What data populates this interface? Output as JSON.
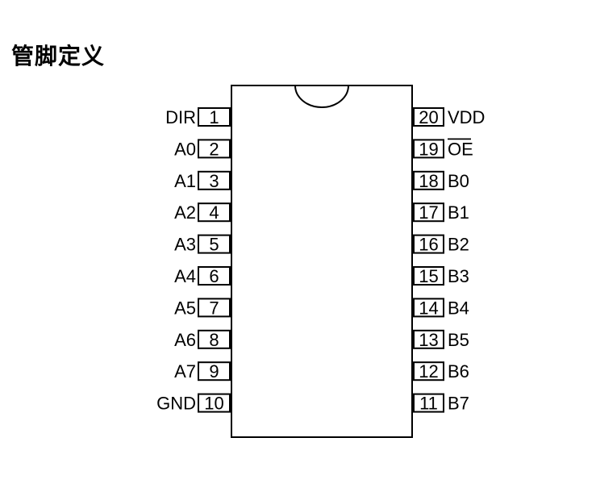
{
  "title": "管脚定义",
  "left_pins": [
    {
      "number": "1",
      "label": "DIR"
    },
    {
      "number": "2",
      "label": "A0"
    },
    {
      "number": "3",
      "label": "A1"
    },
    {
      "number": "4",
      "label": "A2"
    },
    {
      "number": "5",
      "label": "A3"
    },
    {
      "number": "6",
      "label": "A4"
    },
    {
      "number": "7",
      "label": "A5"
    },
    {
      "number": "8",
      "label": "A6"
    },
    {
      "number": "9",
      "label": "A7"
    },
    {
      "number": "10",
      "label": "GND"
    }
  ],
  "right_pins": [
    {
      "number": "20",
      "label": "VDD",
      "overline": false
    },
    {
      "number": "19",
      "label": "OE",
      "overline": true
    },
    {
      "number": "18",
      "label": "B0",
      "overline": false
    },
    {
      "number": "17",
      "label": "B1",
      "overline": false
    },
    {
      "number": "16",
      "label": "B2",
      "overline": false
    },
    {
      "number": "15",
      "label": "B3",
      "overline": false
    },
    {
      "number": "14",
      "label": "B4",
      "overline": false
    },
    {
      "number": "13",
      "label": "B5",
      "overline": false
    },
    {
      "number": "12",
      "label": "B6",
      "overline": false
    },
    {
      "number": "11",
      "label": "B7",
      "overline": false
    }
  ]
}
